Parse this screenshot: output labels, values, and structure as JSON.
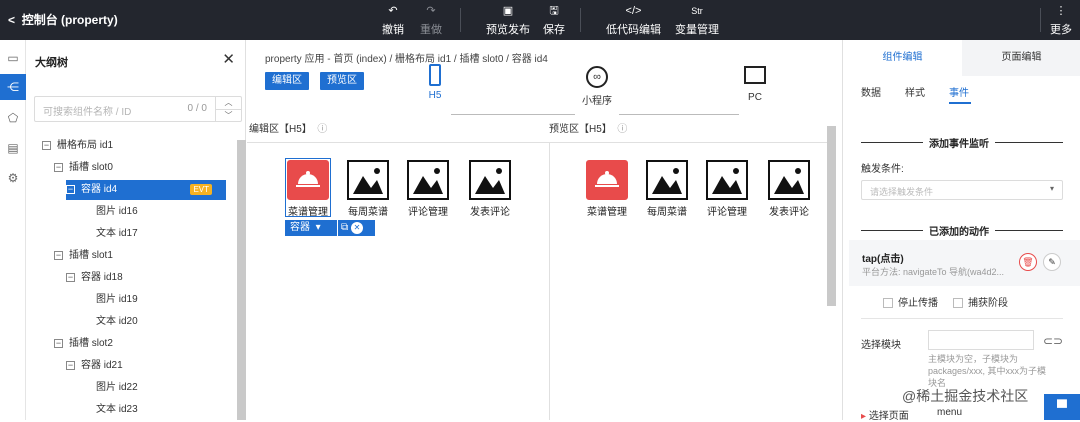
{
  "topbar": {
    "back_label": "控制台 (property)",
    "undo": "撤销",
    "redo": "重做",
    "preview_publish": "预览发布",
    "save": "保存",
    "lowcode_edit": "低代码编辑",
    "var_manage": "变量管理",
    "var_icon_text": "Str",
    "more": "更多"
  },
  "outline": {
    "title": "大纲树",
    "search_placeholder": "可搜索组件名称 / ID",
    "search_count": "0 / 0",
    "nodes": [
      {
        "label": "栅格布局 id1"
      },
      {
        "label": "插槽 slot0"
      },
      {
        "label": "容器 id4",
        "badge": "EVT"
      },
      {
        "label": "图片 id16"
      },
      {
        "label": "文本 id17"
      },
      {
        "label": "插槽 slot1"
      },
      {
        "label": "容器 id18"
      },
      {
        "label": "图片 id19"
      },
      {
        "label": "文本 id20"
      },
      {
        "label": "插槽 slot2"
      },
      {
        "label": "容器 id21"
      },
      {
        "label": "图片 id22"
      },
      {
        "label": "文本 id23"
      }
    ]
  },
  "center": {
    "breadcrumb": "property 应用 - 首页 (index)  /  栅格布局 id1  /  插槽 slot0  /  容器 id4",
    "edit_btn": "编辑区",
    "preview_btn": "预览区",
    "devices": [
      "H5",
      "小程序",
      "PC"
    ],
    "edit_area_title": "编辑区【H5】",
    "preview_area_title": "预览区【H5】",
    "items": [
      "菜谱管理",
      "每周菜谱",
      "评论管理",
      "发表评论"
    ],
    "selection_toolbar": "容器"
  },
  "right": {
    "tabs": [
      "组件编辑",
      "页面编辑"
    ],
    "subtabs": [
      "数据",
      "样式",
      "事件"
    ],
    "add_listener": "添加事件监听",
    "trigger_label": "触发条件:",
    "trigger_placeholder": "请选择触发条件",
    "added_actions": "已添加的动作",
    "action_title": "tap(点击)",
    "action_desc": "平台方法: navigateTo 导航(wa4d2...",
    "stop_propagation": "停止传播",
    "capture_phase": "捕获阶段",
    "select_module": "选择模块",
    "module_note": "主模块为空，子模块为packages/xxx, 其中xxx为子模块名",
    "select_page": "选择页面",
    "page_value": "menu"
  },
  "watermark": "@稀土掘金技术社区",
  "colors": {
    "primary": "#1f6fd1",
    "topbar": "#23262e",
    "evt_badge": "#f5b223",
    "red_icon": "#e84b4b"
  }
}
